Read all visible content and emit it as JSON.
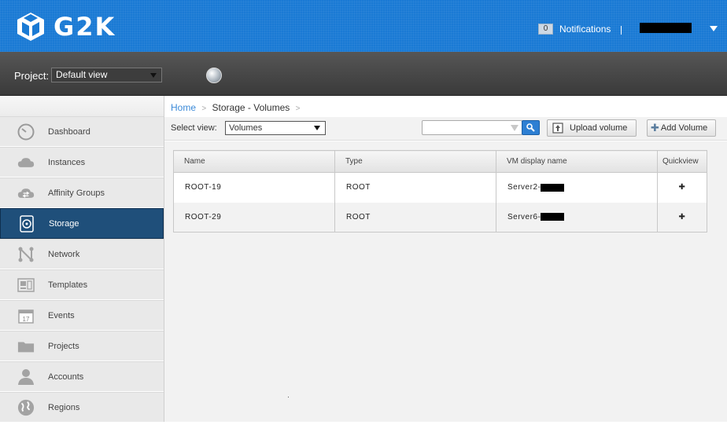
{
  "header": {
    "logo_text": "G2K",
    "notifications": {
      "count": "0",
      "label": "Notifications"
    }
  },
  "project_bar": {
    "label": "Project:",
    "selected": "Default view"
  },
  "sidebar": {
    "items": [
      {
        "label": "Dashboard",
        "icon": "gauge-icon",
        "active": false
      },
      {
        "label": "Instances",
        "icon": "cloud-icon",
        "active": false
      },
      {
        "label": "Affinity Groups",
        "icon": "cloud-arrows-icon",
        "active": false
      },
      {
        "label": "Storage",
        "icon": "disk-icon",
        "active": true
      },
      {
        "label": "Network",
        "icon": "network-icon",
        "active": false
      },
      {
        "label": "Templates",
        "icon": "templates-icon",
        "active": false
      },
      {
        "label": "Events",
        "icon": "calendar-icon",
        "active": false
      },
      {
        "label": "Projects",
        "icon": "folder-icon",
        "active": false
      },
      {
        "label": "Accounts",
        "icon": "user-icon",
        "active": false
      },
      {
        "label": "Regions",
        "icon": "globe-icon",
        "active": false
      }
    ],
    "events_day": "17"
  },
  "breadcrumb": {
    "home": "Home",
    "current": "Storage - Volumes"
  },
  "toolbar": {
    "select_label": "Select view:",
    "select_value": "Volumes",
    "upload_label": "Upload volume",
    "add_label": "Add Volume"
  },
  "table": {
    "headers": [
      "Name",
      "Type",
      "VM display name",
      "Quickview"
    ],
    "rows": [
      {
        "name": "ROOT-19",
        "type": "ROOT",
        "vm": "Server2-"
      },
      {
        "name": "ROOT-29",
        "type": "ROOT",
        "vm": "Server6-"
      }
    ]
  },
  "colors": {
    "header_blue": "#1a7ad4",
    "active_nav": "#1f4f7a",
    "link_blue": "#3b8ad8"
  }
}
